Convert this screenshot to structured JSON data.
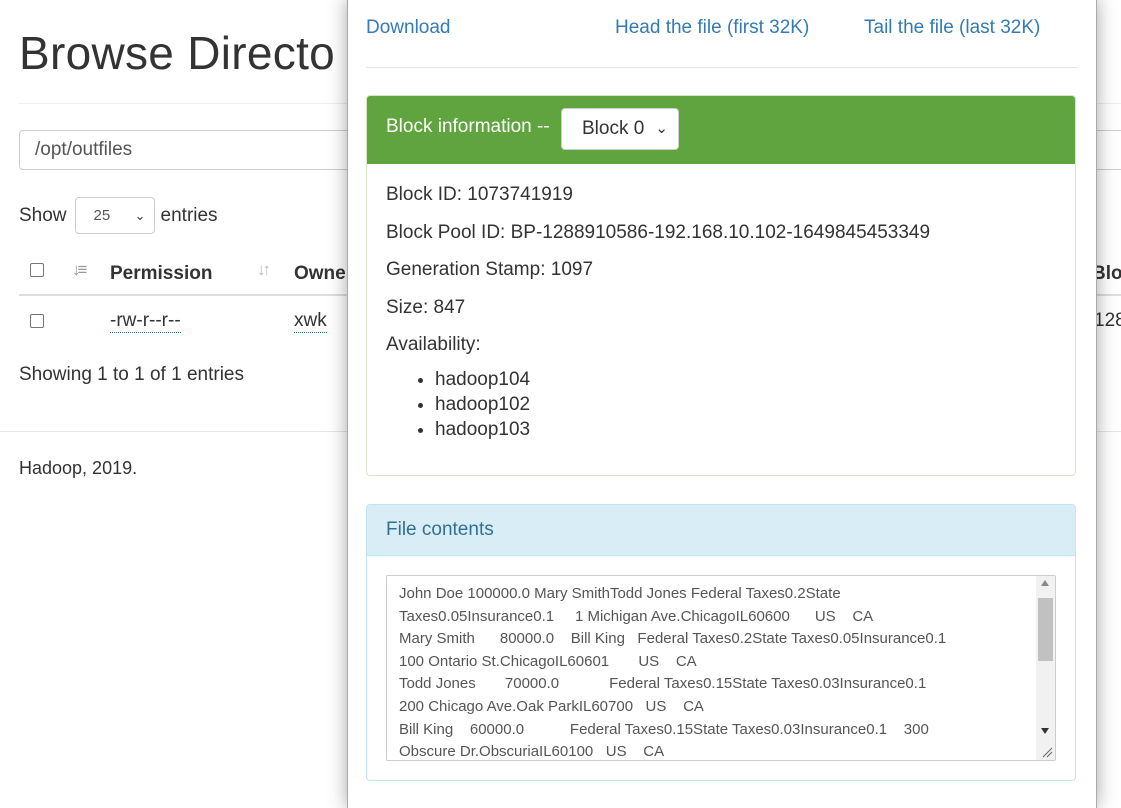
{
  "page": {
    "title": "Browse Directo",
    "path_value": "/opt/outfiles",
    "show_label": "Show",
    "entries_label": "entries",
    "page_size": "25",
    "columns": {
      "permission": "Permission",
      "owner": "Owne",
      "block": "Bloc"
    },
    "rows": [
      {
        "permission": "-rw-r--r--",
        "owner": "xwk",
        "block": "128"
      }
    ],
    "info": "Showing 1 to 1 of 1 entries",
    "footer": "Hadoop, 2019."
  },
  "modal": {
    "links": {
      "download": "Download",
      "head": "Head the file (first 32K)",
      "tail": "Tail the file (last 32K)"
    },
    "block_panel": {
      "title": "Block information --",
      "selected_block": "Block 0",
      "block_id": "Block ID: 1073741919",
      "block_pool_id": "Block Pool ID: BP-1288910586-192.168.10.102-1649845453349",
      "generation_stamp": "Generation Stamp: 1097",
      "size": "Size: 847",
      "availability_label": "Availability:",
      "availability": [
        "hadoop104",
        "hadoop102",
        "hadoop103"
      ]
    },
    "file_panel": {
      "title": "File contents",
      "lines": [
        "John Doe 100000.0 Mary SmithTodd Jones Federal Taxes0.2State",
        "Taxes0.05Insurance0.1     1 Michigan Ave.ChicagoIL60600      US    CA",
        "Mary Smith      80000.0    Bill King   Federal Taxes0.2State Taxes0.05Insurance0.1",
        "100 Ontario St.ChicagoIL60601       US    CA",
        "Todd Jones       70000.0            Federal Taxes0.15State Taxes0.03Insurance0.1",
        "200 Chicago Ave.Oak ParkIL60700   US    CA",
        "Bill King    60000.0           Federal Taxes0.15State Taxes0.03Insurance0.1    300",
        "Obscure Dr.ObscuriaIL60100   US    CA"
      ]
    }
  },
  "colors": {
    "block_header": "#5fa43e",
    "file_header": "#d9edf7",
    "link": "#337ab7"
  }
}
